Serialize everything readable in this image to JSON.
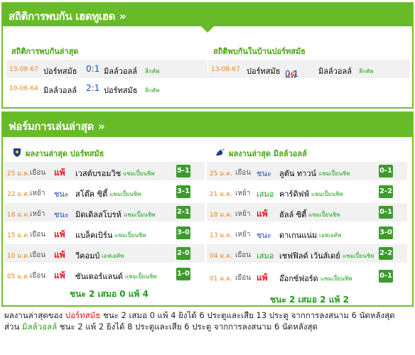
{
  "h2h": {
    "title": "สถิติการพบกัน เฮดทูเฮด",
    "chevron": "»",
    "recent_title": "สถิติการพบกันล่าสุด",
    "home_title": "สถิติพบกันในบ้านปอร์ทสมัธ",
    "recent": [
      {
        "date": "13-08-67",
        "home": "ปอร์ทสมัธ",
        "score": "0:1",
        "away": "มิลล์วอลล์",
        "league": "ลีกคัพ"
      },
      {
        "date": "10-08-64",
        "home": "มิลล์วอลล์",
        "score": "2:1",
        "away": "ปอร์ทสมัธ",
        "league": "ลีกคัพ"
      }
    ],
    "home": [
      {
        "date": "13-08-67",
        "home": "ปอร์ทสมัธ",
        "result": "แพ้",
        "score": "0:1",
        "away": "มิลล์วอลล์",
        "league": "ลีกคัพ"
      }
    ]
  },
  "form": {
    "title": "ฟอร์มการเล่นล่าสุด",
    "chevron": "»",
    "left_title": "ผลงานล่าสุด ปอร์ทสมัธ",
    "right_title": "ผลงานล่าสุด มิลล์วอลล์",
    "left": [
      {
        "date": "25 ม.ค.",
        "ha": "เยือน",
        "result": "แพ้",
        "rtype": "l",
        "opp": "เวสต์บรอมวิช",
        "league": "แชมเปี้ยนชิพ",
        "score": "5-1"
      },
      {
        "date": "22 ม.ค.",
        "ha": "เหย้า",
        "result": "ชนะ",
        "rtype": "w",
        "opp": "สโต๊ค ซิตี้",
        "league": "แชมเปี้ยนชิพ",
        "score": "3-1"
      },
      {
        "date": "18 ม.ค.",
        "ha": "เหย้า",
        "result": "ชนะ",
        "rtype": "w",
        "opp": "มิดเดิลสโบรห์",
        "league": "แชมเปี้ยนชิพ",
        "score": "2-1"
      },
      {
        "date": "15 ม.ค.",
        "ha": "เยือน",
        "result": "แพ้",
        "rtype": "l",
        "opp": "แบล็คเบิร์น",
        "league": "แชมเปี้ยนชิพ",
        "score": "3-0"
      },
      {
        "date": "10 ม.ค.",
        "ha": "เยือน",
        "result": "แพ้",
        "rtype": "l",
        "opp": "วีคอมบ์",
        "league": "เอฟเอคัพ",
        "score": "2-0"
      },
      {
        "date": "05 ม.ค.",
        "ha": "เยือน",
        "result": "แพ้",
        "rtype": "l",
        "opp": "ซันเดอร์แลนด์",
        "league": "แชมเปี้ยนชิพ",
        "score": "1-0"
      }
    ],
    "right": [
      {
        "date": "25 ม.ค.",
        "ha": "เยือน",
        "result": "ชนะ",
        "rtype": "w",
        "opp": "ลูตัน ทาวน์",
        "league": "แชมเปี้ยนชิพ",
        "score": "0-1"
      },
      {
        "date": "21 ม.ค.",
        "ha": "เหย้า",
        "result": "เสมอ",
        "rtype": "d",
        "opp": "คาร์ดิฟฟ์",
        "league": "แชมเปี้ยนชิพ",
        "score": "2-2"
      },
      {
        "date": "18 ม.ค.",
        "ha": "เหย้า",
        "result": "แพ้",
        "rtype": "l",
        "opp": "ฮัลล์ ซิตี้",
        "league": "แชมเปี้ยนชิพ",
        "score": "0-1"
      },
      {
        "date": "13 ม.ค.",
        "ha": "เหย้า",
        "result": "ชนะ",
        "rtype": "w",
        "opp": "ดาเกนแน่ม",
        "league": "เอฟเอคัพ",
        "score": "3-0"
      },
      {
        "date": "04 ม.ค.",
        "ha": "เยือน",
        "result": "เสมอ",
        "rtype": "d",
        "opp": "เชฟฟิลด์ เว้นส์เดย์",
        "league": "แชมเปี้ยนชิพ",
        "score": "2-2"
      },
      {
        "date": "01 ม.ค.",
        "ha": "เยือน",
        "result": "แพ้",
        "rtype": "l",
        "opp": "อ๊อกซ์ฟอร์ด",
        "league": "แชมเปี้ยนชิพ",
        "score": "0-1"
      }
    ],
    "left_summary": "ชนะ 2 เสมอ 0 แพ้ 4",
    "right_summary": "ชนะ 2 เสมอ 2 แพ้ 2"
  },
  "footer": {
    "line1_pre": "ผลงานล่าสุดของ ",
    "line1_team": "ปอร์ทสมัธ",
    "line1_post": " ชนะ 2 เสมอ 0 แพ้ 4 ยิงได้ 6 ประตูและเสีย 13 ประตู จากการลงสนาม 6 นัดหลังสุด",
    "line2_pre": "ส่วน ",
    "line2_team": "มิลล์วอลล์",
    "line2_post": " ชนะ 2 แพ้ 2 ยิงได้ 8 ประตูและเสีย 6 ประตู จากการลงสนาม 6 นัดหลังสุด"
  },
  "colors": {
    "accent": "#68bb28",
    "loss": "#e8141b",
    "win": "#1f4dbd",
    "draw": "#1f9a1f",
    "badge": "#3f9a2e"
  }
}
